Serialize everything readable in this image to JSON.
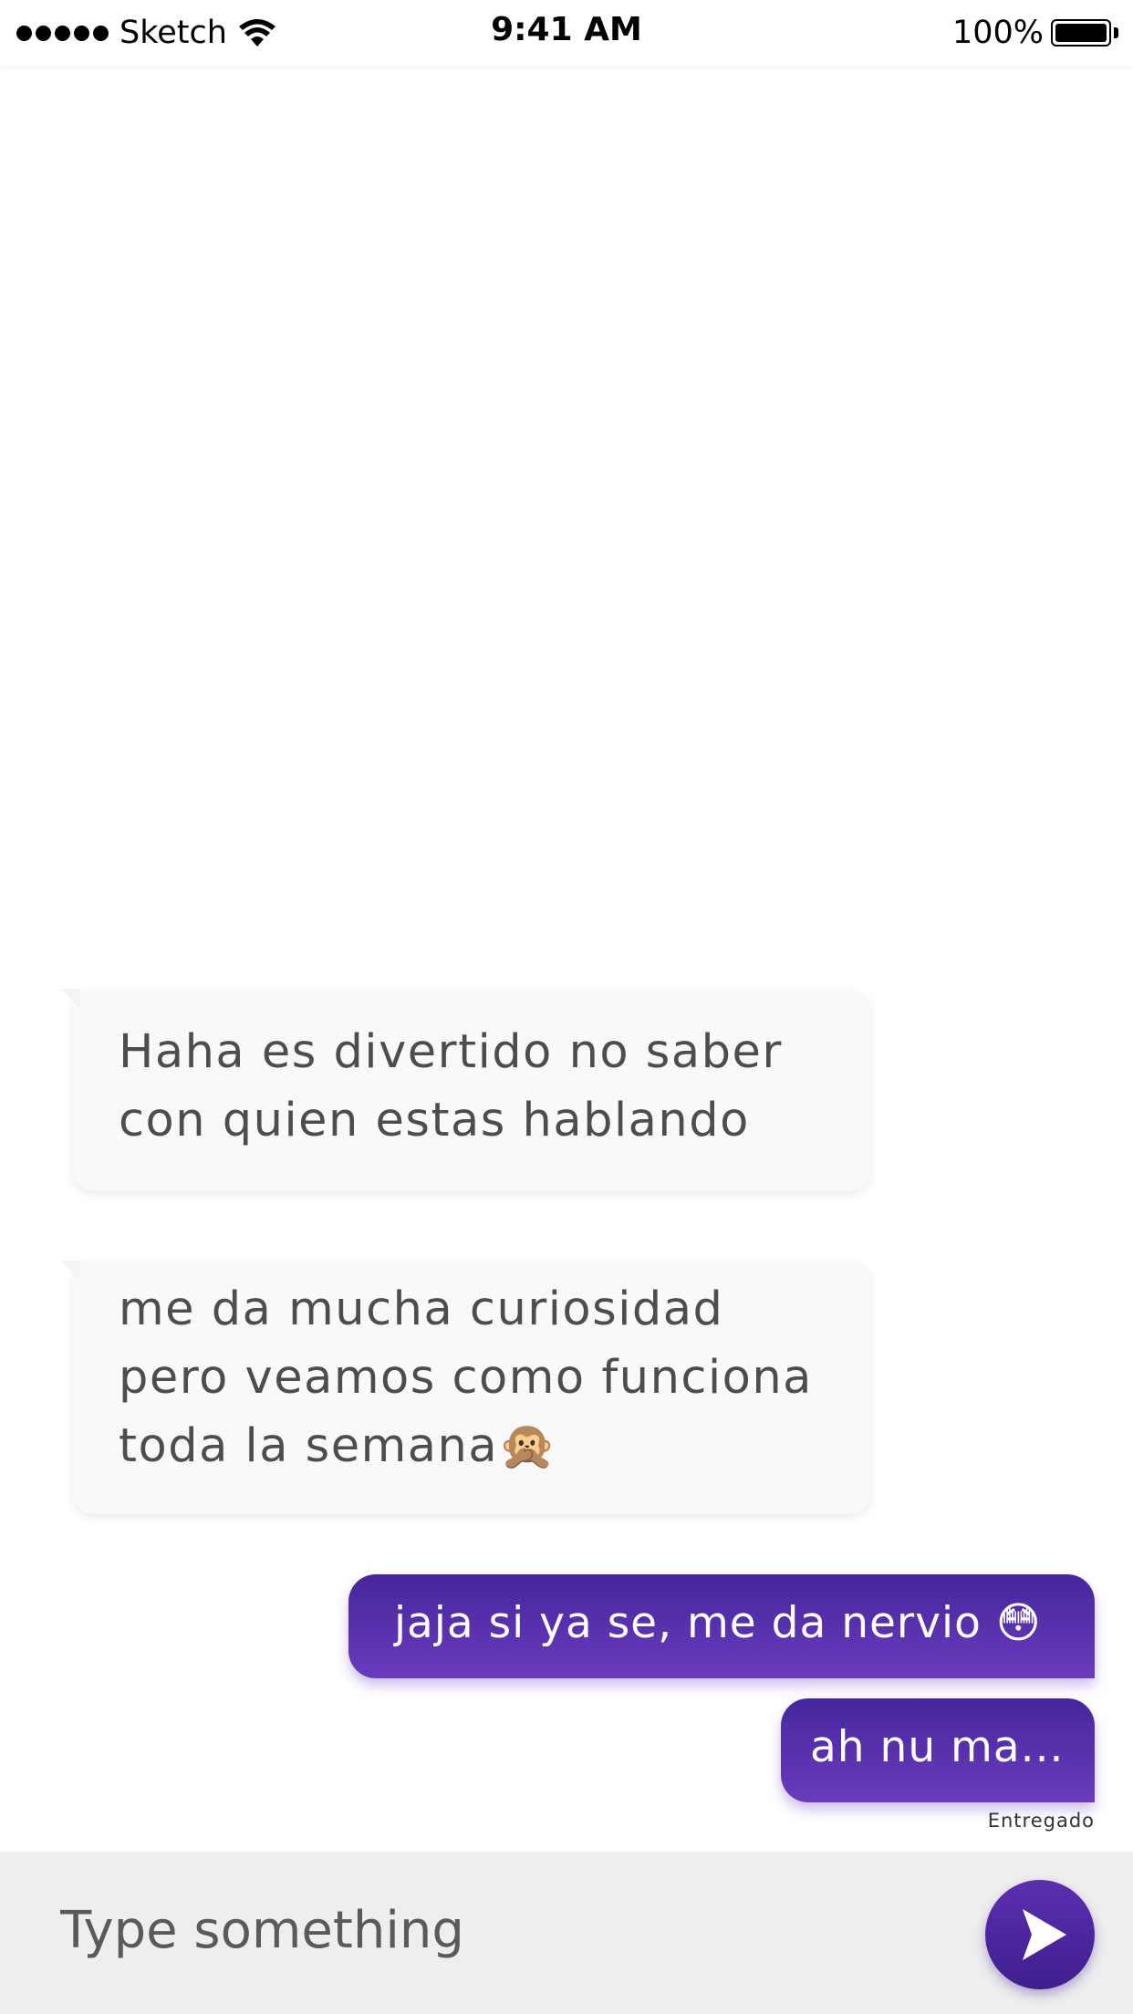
{
  "status_bar": {
    "carrier": "Sketch",
    "time": "9:41 AM",
    "battery": "100%"
  },
  "messages": [
    {
      "direction": "incoming",
      "lines": [
        "Haha es divertido no saber",
        "con quien estas hablando"
      ]
    },
    {
      "direction": "incoming",
      "lines": [
        "me da mucha curiosidad",
        "pero veamos como funciona",
        "toda la semana🙊"
      ]
    },
    {
      "direction": "outgoing",
      "text": "jaja si ya se, me da nervio 😳"
    },
    {
      "direction": "outgoing",
      "text": "ah nu ma..."
    }
  ],
  "delivery_status": "Entregado",
  "composer": {
    "placeholder": "Type something"
  },
  "colors": {
    "accent": "#4b2aa0",
    "accent_light": "#6a3bbd",
    "incoming_bubble": "#f9f9f9",
    "input_bar": "#eeeeee"
  },
  "icons": [
    "wifi-icon",
    "battery-icon",
    "send-icon"
  ]
}
